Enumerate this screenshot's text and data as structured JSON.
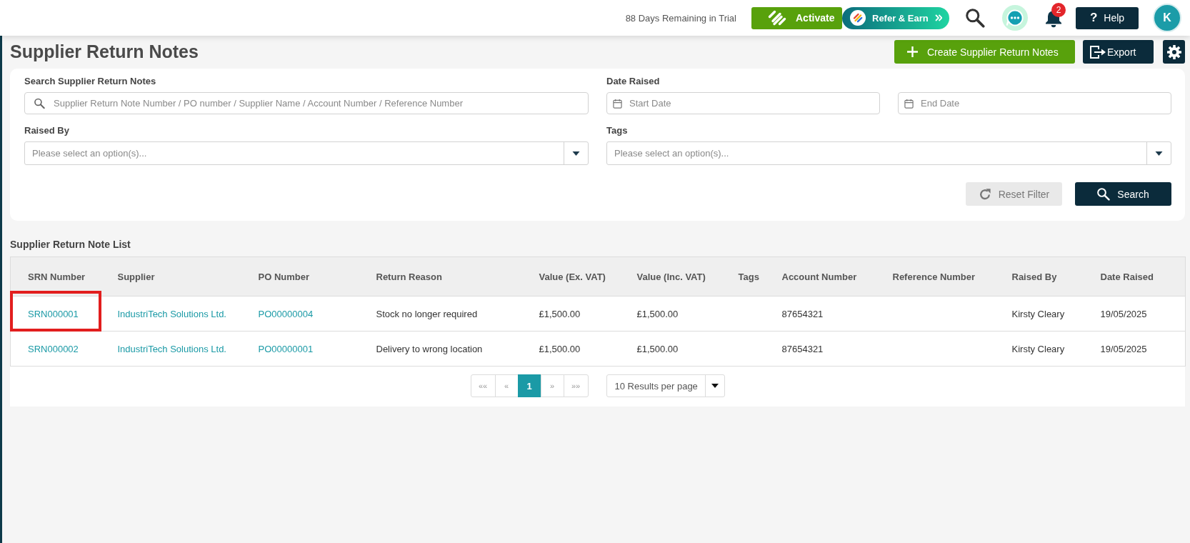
{
  "top_bar": {
    "trial_notice": "88 Days Remaining in Trial",
    "activate_button": {
      "label": "Activate"
    },
    "refer_button": {
      "label": "Refer & Earn"
    },
    "notifications": {
      "badge": "2"
    },
    "help_button": {
      "icon": "?",
      "label": "Help"
    },
    "avatar": {
      "initial": "K"
    }
  },
  "header": {
    "title": "Supplier Return Notes",
    "actions": [
      {
        "kind": "create",
        "label": "Create Supplier Return Notes"
      },
      {
        "kind": "export",
        "label": "Export"
      },
      {
        "kind": "settings"
      }
    ]
  },
  "filters": {
    "search": {
      "label": "Search Supplier Return Notes",
      "placeholder": "Supplier Return Note Number / PO number / Supplier Name / Account Number / Reference Number"
    },
    "date_raised": {
      "label": "Date Raised",
      "start": {
        "placeholder": "Start Date"
      },
      "end": {
        "placeholder": "End Date"
      }
    },
    "raised_by": {
      "label": "Raised By",
      "placeholder": "Please select an option(s)..."
    },
    "tags": {
      "label": "Tags",
      "placeholder": "Please select an option(s)..."
    },
    "buttons": [
      {
        "kind": "reset",
        "label": "Reset Filter",
        "disabled": true
      },
      {
        "kind": "search",
        "label": "Search",
        "disabled": false
      }
    ]
  },
  "list": {
    "title": "Supplier Return Note List",
    "columns": [
      "SRN Number",
      "Supplier",
      "PO Number",
      "Return Reason",
      "Value (Ex. VAT)",
      "Value (Inc. VAT)",
      "Tags",
      "Account Number",
      "Reference Number",
      "Raised By",
      "Date Raised"
    ],
    "rows": [
      {
        "highlighted": true,
        "srn_number": "SRN000001",
        "supplier": "IndustriTech Solutions Ltd.",
        "po_number": "PO00000004",
        "return_reason": "Stock no longer required",
        "value_ex_vat": "£1,500.00",
        "value_inc_vat": "£1,500.00",
        "account_number": "87654321",
        "raised_by": "Kirsty Cleary",
        "date_raised": "19/05/2025"
      },
      {
        "highlighted": false,
        "srn_number": "SRN000002",
        "supplier": "IndustriTech Solutions Ltd.",
        "po_number": "PO00000001",
        "return_reason": "Delivery to wrong location",
        "value_ex_vat": "£1,500.00",
        "value_inc_vat": "£1,500.00",
        "account_number": "87654321",
        "raised_by": "Kirsty Cleary",
        "date_raised": "19/05/2025"
      }
    ],
    "pagination": {
      "pages": [
        {
          "label": "««",
          "selected": false
        },
        {
          "label": "«",
          "selected": false
        },
        {
          "label": "1",
          "selected": true
        },
        {
          "label": "»",
          "selected": false
        },
        {
          "label": "»»",
          "selected": false
        }
      ],
      "page_size": "10 Results per page"
    }
  }
}
